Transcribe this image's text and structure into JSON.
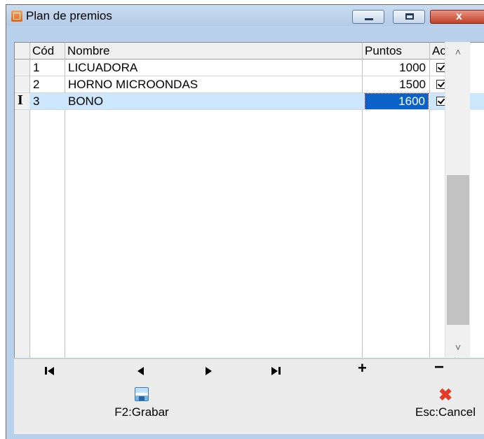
{
  "window": {
    "title": "Plan de premios",
    "close_glyph": "x"
  },
  "grid": {
    "columns": [
      "Cód",
      "Nombre",
      "Puntos",
      "Act"
    ],
    "rows": [
      {
        "code": "1",
        "name": "LICUADORA",
        "points": "1000",
        "active": true
      },
      {
        "code": "2",
        "name": "HORNO MICROONDAS",
        "points": "1500",
        "active": true
      },
      {
        "code": "3",
        "name": "BONO",
        "points": "1600",
        "active": true
      }
    ],
    "current_row_indicator": "I",
    "selected_row": 3
  },
  "navigator": {
    "icons": [
      "first-record-icon",
      "prior-record-icon",
      "next-record-icon",
      "last-record-icon",
      "insert-record-icon",
      "delete-record-icon"
    ]
  },
  "actions": {
    "save_label": "F2:Grabar",
    "cancel_label": "Esc:Cancel"
  },
  "colors": {
    "selected_row_bg": "#cce6fb",
    "focused_cell_bg": "#0a62c8",
    "cancel_icon": "#e43b25",
    "close_button": "#c2402a"
  }
}
